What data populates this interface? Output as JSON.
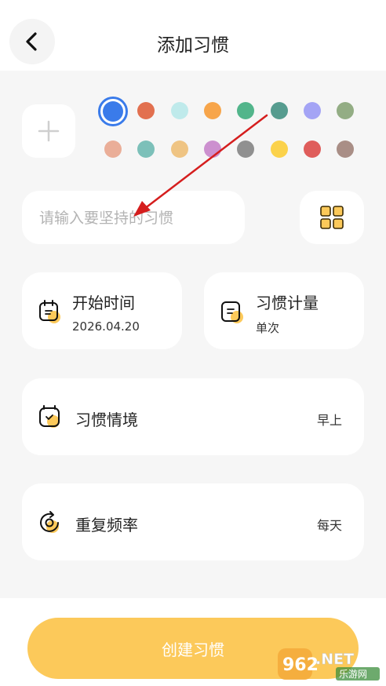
{
  "header": {
    "title": "添加习惯",
    "back_icon": "chevron-left-icon"
  },
  "colors": {
    "selected": "#3a7bea",
    "palette": [
      "#3a7bea",
      "#e2704f",
      "#bfeaeb",
      "#f7a54a",
      "#52b58b",
      "#569c8f",
      "#a4a4f5",
      "#93ad84",
      "#eaae98",
      "#7cc0b9",
      "#efc483",
      "#cc90cf",
      "#909090",
      "#fbd24b",
      "#df5d5b",
      "#a98e86"
    ],
    "accent": "#fcc95a",
    "arrow": "#d51e1e"
  },
  "habit_name": {
    "placeholder": "请输入要坚持的习惯",
    "value": ""
  },
  "start_time": {
    "title": "开始时间",
    "value": "2026.04.20"
  },
  "habit_measure": {
    "title": "习惯计量",
    "value": "单次"
  },
  "habit_context": {
    "title": "习惯情境",
    "value": "早上"
  },
  "repeat_frequency": {
    "title": "重复频率",
    "value": "每天"
  },
  "create_button": {
    "label": "创建习惯"
  },
  "watermark": {
    "brand": "962",
    "suffix": ".NET",
    "subtitle": "乐游网"
  }
}
